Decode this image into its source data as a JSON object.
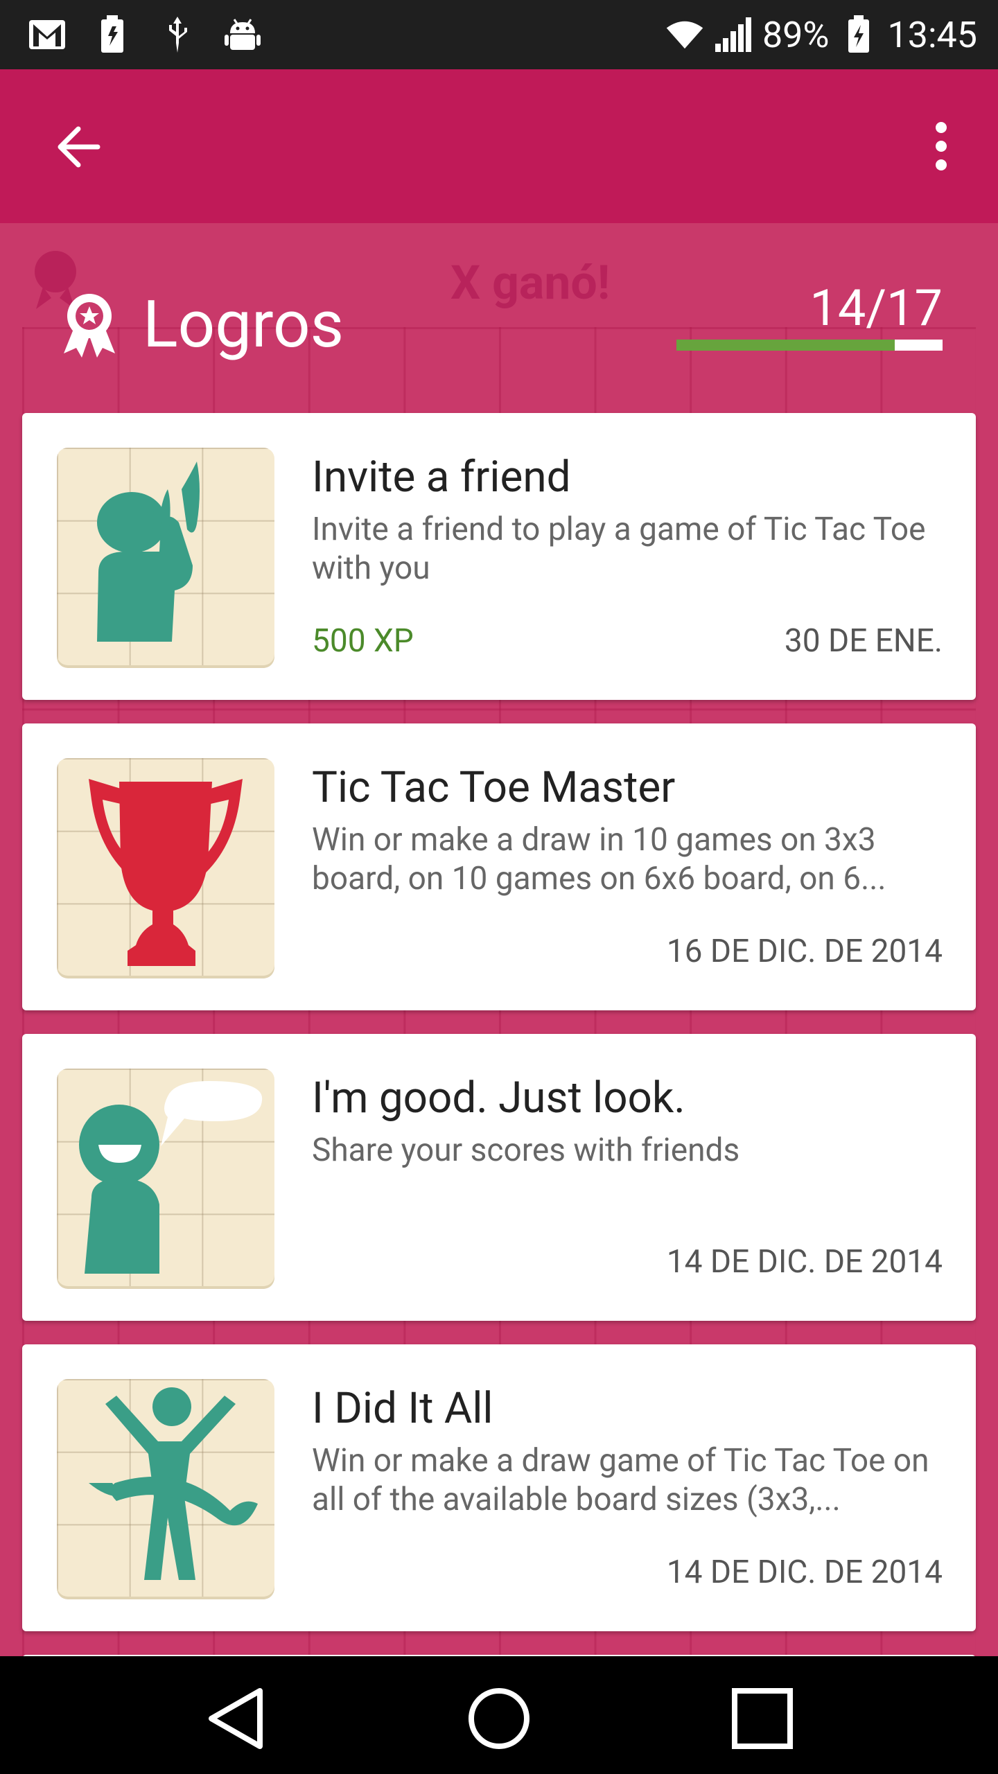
{
  "status_bar": {
    "battery_percent": "89%",
    "time": "13:45",
    "icons": [
      "gmail-icon",
      "battery-saver-icon",
      "usb-icon",
      "android-debug-icon",
      "wifi-icon",
      "signal-icon",
      "battery-charging-icon"
    ]
  },
  "app_bar": {
    "back_icon": "arrow-back-icon",
    "overflow_icon": "more-vert-icon"
  },
  "header": {
    "title": "Logros",
    "count": "14/17",
    "progress": 0.82,
    "icon": "award-ribbon-icon"
  },
  "achievements": [
    {
      "title": "Invite a friend",
      "description": "Invite a friend to play a game of Tic Tac Toe with you",
      "xp": "500 XP",
      "date": "30 DE ENE.",
      "icon": "person-shouting-icon"
    },
    {
      "title": "Tic Tac Toe Master",
      "description": "Win or make a draw in 10 games on 3x3 board, on 10 games on 6x6 board, on 6...",
      "xp": "",
      "date": "16 DE DIC. DE 2014",
      "icon": "trophy-icon"
    },
    {
      "title": "I'm good. Just look.",
      "description": "Share your scores with friends",
      "xp": "",
      "date": "14 DE DIC. DE 2014",
      "icon": "person-speech-bubble-icon"
    },
    {
      "title": "I Did It All",
      "description": "Win or make a draw game of Tic Tac Toe on all of the available board sizes (3x3,...",
      "xp": "",
      "date": "14 DE DIC. DE 2014",
      "icon": "finish-line-runner-icon"
    }
  ],
  "background": {
    "status_text": "X ganó!"
  },
  "nav_bar": {
    "back": "nav-back-icon",
    "home": "nav-home-icon",
    "recents": "nav-recents-icon"
  },
  "colors": {
    "app_bar": "#c01a58",
    "overlay": "#c9396a",
    "progress": "#67a43d",
    "xp_text": "#4b8a2a",
    "icon_teal": "#3a9e87",
    "trophy_red": "#d9263a"
  }
}
